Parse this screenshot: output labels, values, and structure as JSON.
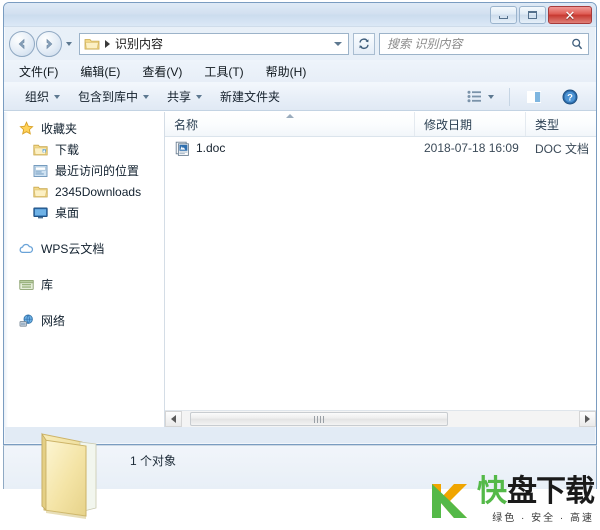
{
  "window": {
    "title": "识别内容",
    "controls": {
      "minimize": "最小化",
      "maximize": "最大化",
      "close": "✕"
    }
  },
  "navigation": {
    "back_label": "后退",
    "forward_label": "前进",
    "recent_dropdown_label": "最近浏览的位置",
    "refresh_label": "刷新"
  },
  "address": {
    "folder_icon": "folder-icon",
    "separator": "▸",
    "crumb": "识别内容"
  },
  "search": {
    "placeholder": "搜索 识别内容",
    "icon": "search-icon"
  },
  "menubar": {
    "items": [
      {
        "label": "文件(F)"
      },
      {
        "label": "编辑(E)"
      },
      {
        "label": "查看(V)"
      },
      {
        "label": "工具(T)"
      },
      {
        "label": "帮助(H)"
      }
    ]
  },
  "toolbar": {
    "organize": "组织",
    "include_in_library": "包含到库中",
    "share": "共享",
    "new_folder": "新建文件夹",
    "view_icon": "view-list-icon",
    "preview_icon": "preview-pane-icon",
    "help_icon": "help-icon"
  },
  "sidebar": {
    "groups": [
      {
        "head": {
          "label": "收藏夹",
          "icon": "star-icon"
        },
        "children": [
          {
            "label": "下载",
            "icon": "downloads-folder-icon"
          },
          {
            "label": "最近访问的位置",
            "icon": "recent-places-icon"
          },
          {
            "label": "2345Downloads",
            "icon": "folder-icon"
          },
          {
            "label": "桌面",
            "icon": "desktop-icon"
          }
        ]
      },
      {
        "head": {
          "label": "WPS云文档",
          "icon": "cloud-icon"
        },
        "children": []
      },
      {
        "head": {
          "label": "库",
          "icon": "library-icon"
        },
        "children": []
      },
      {
        "head": {
          "label": "网络",
          "icon": "network-icon"
        },
        "children": []
      }
    ]
  },
  "filelist": {
    "columns": [
      {
        "label": "名称",
        "sorted": "asc"
      },
      {
        "label": "修改日期",
        "sorted": ""
      },
      {
        "label": "类型",
        "sorted": ""
      }
    ],
    "rows": [
      {
        "icon": "doc-file-icon",
        "name": "1.doc",
        "date": "2018-07-18 16:09",
        "type": "DOC 文档"
      }
    ]
  },
  "scrollbar": {
    "left_arrow": "◀",
    "right_arrow": "▶"
  },
  "statusbar": {
    "text": "1 个对象",
    "folder_icon": "open-folder-icon"
  },
  "watermark": {
    "logo": "k-logo-icon",
    "word_green": "快",
    "word_black": "盘下载",
    "tagline": "绿色 · 安全 · 高速"
  },
  "colors": {
    "accent": "#54b948",
    "close_red": "#c6372f",
    "frame_border": "#7a9cc0",
    "folder_yellow": "#f7e08e"
  }
}
